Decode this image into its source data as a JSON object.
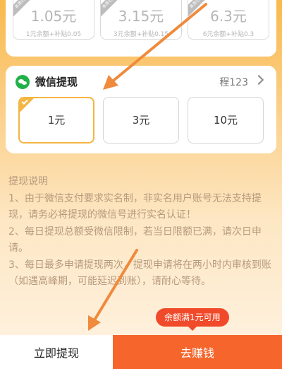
{
  "top_options": [
    {
      "amount": "1.05元",
      "subtitle": "1元余额+补贴0.05",
      "ribbon": "本周已领"
    },
    {
      "amount": "3.15元",
      "subtitle": "3元余额+补贴0.15",
      "ribbon": "本周已领"
    },
    {
      "amount": "6.3元",
      "subtitle": "6元余额+补贴0.3",
      "ribbon": "本周已领"
    }
  ],
  "wechat": {
    "title": "微信提现",
    "account": "程123",
    "icon": "wechat-icon",
    "options": [
      {
        "label": "1元",
        "selected": true
      },
      {
        "label": "3元",
        "selected": false
      },
      {
        "label": "10元",
        "selected": false
      }
    ]
  },
  "instructions": {
    "heading": "提现说明",
    "items": [
      "1、由于微信支付要求实名制，非实名用户账号无法支持提现，请务必将提现的微信号进行实名认证！",
      "2、每日提现总额受微信限制，若当日限额已满，请次日申请。",
      "3、每日最多申请提现两次，提现申请将在两小时内审核到账（如遇高峰期，可能延迟到账），请耐心等待。"
    ]
  },
  "bottom": {
    "withdraw_label": "立即提现",
    "earn_label": "去赚钱",
    "bubble": "余额满1元可用"
  },
  "colors": {
    "accent": "#f5b541",
    "earn_button": "#f5652c",
    "bubble": "#f04a2a",
    "arrow": "#f08a3c",
    "wechat_green": "#21b14a"
  }
}
